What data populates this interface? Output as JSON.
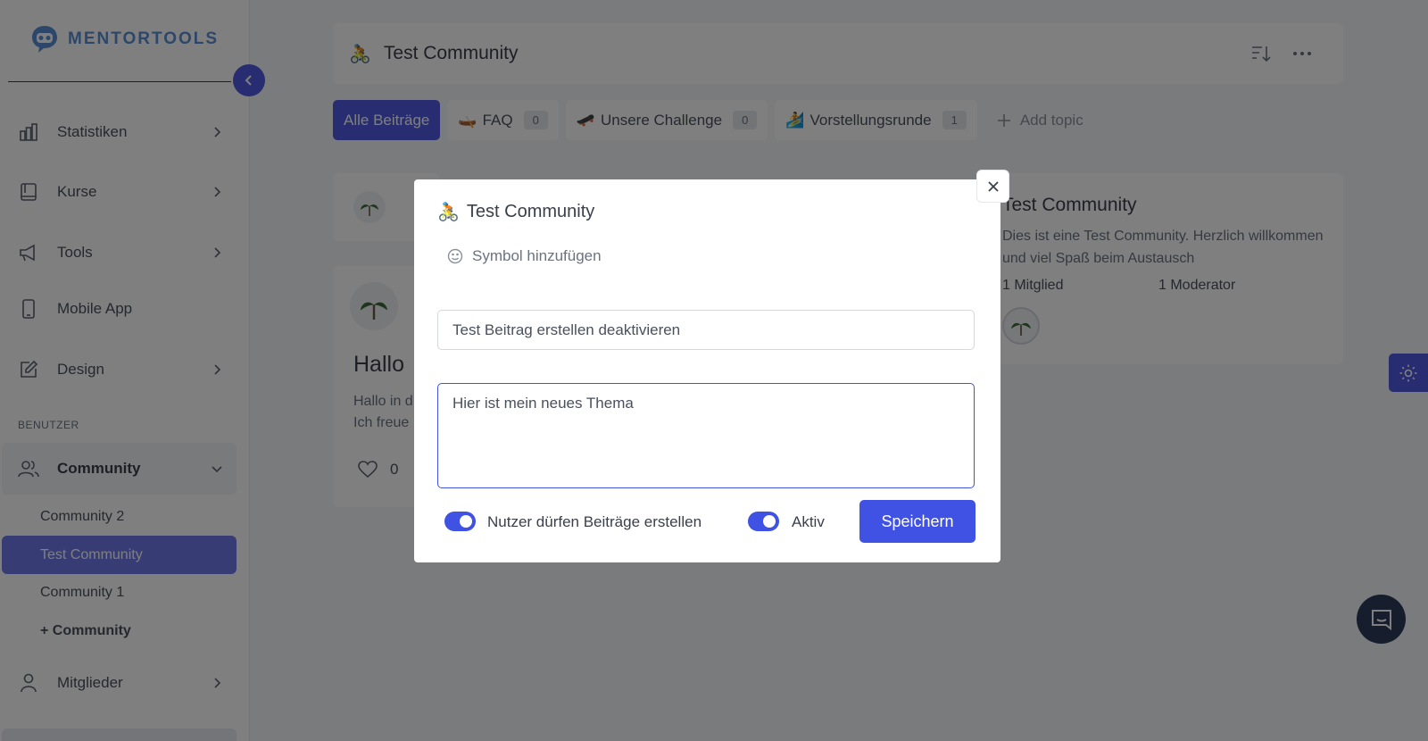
{
  "brand": {
    "name": "MENTORTOOLS"
  },
  "sidebar": {
    "items": [
      {
        "label": "Statistiken",
        "icon": "bar-chart-icon"
      },
      {
        "label": "Kurse",
        "icon": "book-icon"
      },
      {
        "label": "Tools",
        "icon": "megaphone-icon"
      },
      {
        "label": "Mobile App",
        "icon": "phone-icon"
      },
      {
        "label": "Design",
        "icon": "edit-icon"
      }
    ],
    "section_label": "BENUTZER",
    "community": {
      "label": "Community",
      "subitems": [
        "Community 2",
        "Test Community",
        "Community 1",
        "+ Community"
      ]
    },
    "members": {
      "label": "Mitglieder"
    }
  },
  "topbar": {
    "title": "Test Community"
  },
  "tabs": [
    {
      "label": "Alle Beiträge",
      "active": true
    },
    {
      "emoji": "🛶",
      "label": "FAQ",
      "count": "0"
    },
    {
      "emoji": "🛹",
      "label": "Unsere Challenge",
      "count": "0"
    },
    {
      "emoji": "🏄",
      "label": "Vorstellungsrunde",
      "count": "1"
    }
  ],
  "add_topic": "Add topic",
  "post": {
    "title": "Hallo",
    "text_lines": [
      "Hallo in d",
      "Ich freue"
    ],
    "likes": "0"
  },
  "info": {
    "title": "Test Community",
    "description": "Dies ist eine Test Community. Herzlich willkommen und viel Spaß beim Austausch",
    "members": "1 Mitglied",
    "moderators": "1 Moderator"
  },
  "modal": {
    "title": "Test Community",
    "symbol_label": "Symbol hinzufügen",
    "name_value": "Test Beitrag erstellen deaktivieren",
    "description_value": "Hier ist mein neues Thema",
    "toggle_users_label": "Nutzer dürfen Beiträge erstellen",
    "toggle_users_on": true,
    "toggle_active_label": "Aktiv",
    "toggle_active_on": true,
    "save_label": "Speichern"
  },
  "colors": {
    "accent": "#3f52e3",
    "active_nav": "#6f78ea",
    "brand": "#5b8fd6",
    "chat": "#2c3a5a"
  }
}
